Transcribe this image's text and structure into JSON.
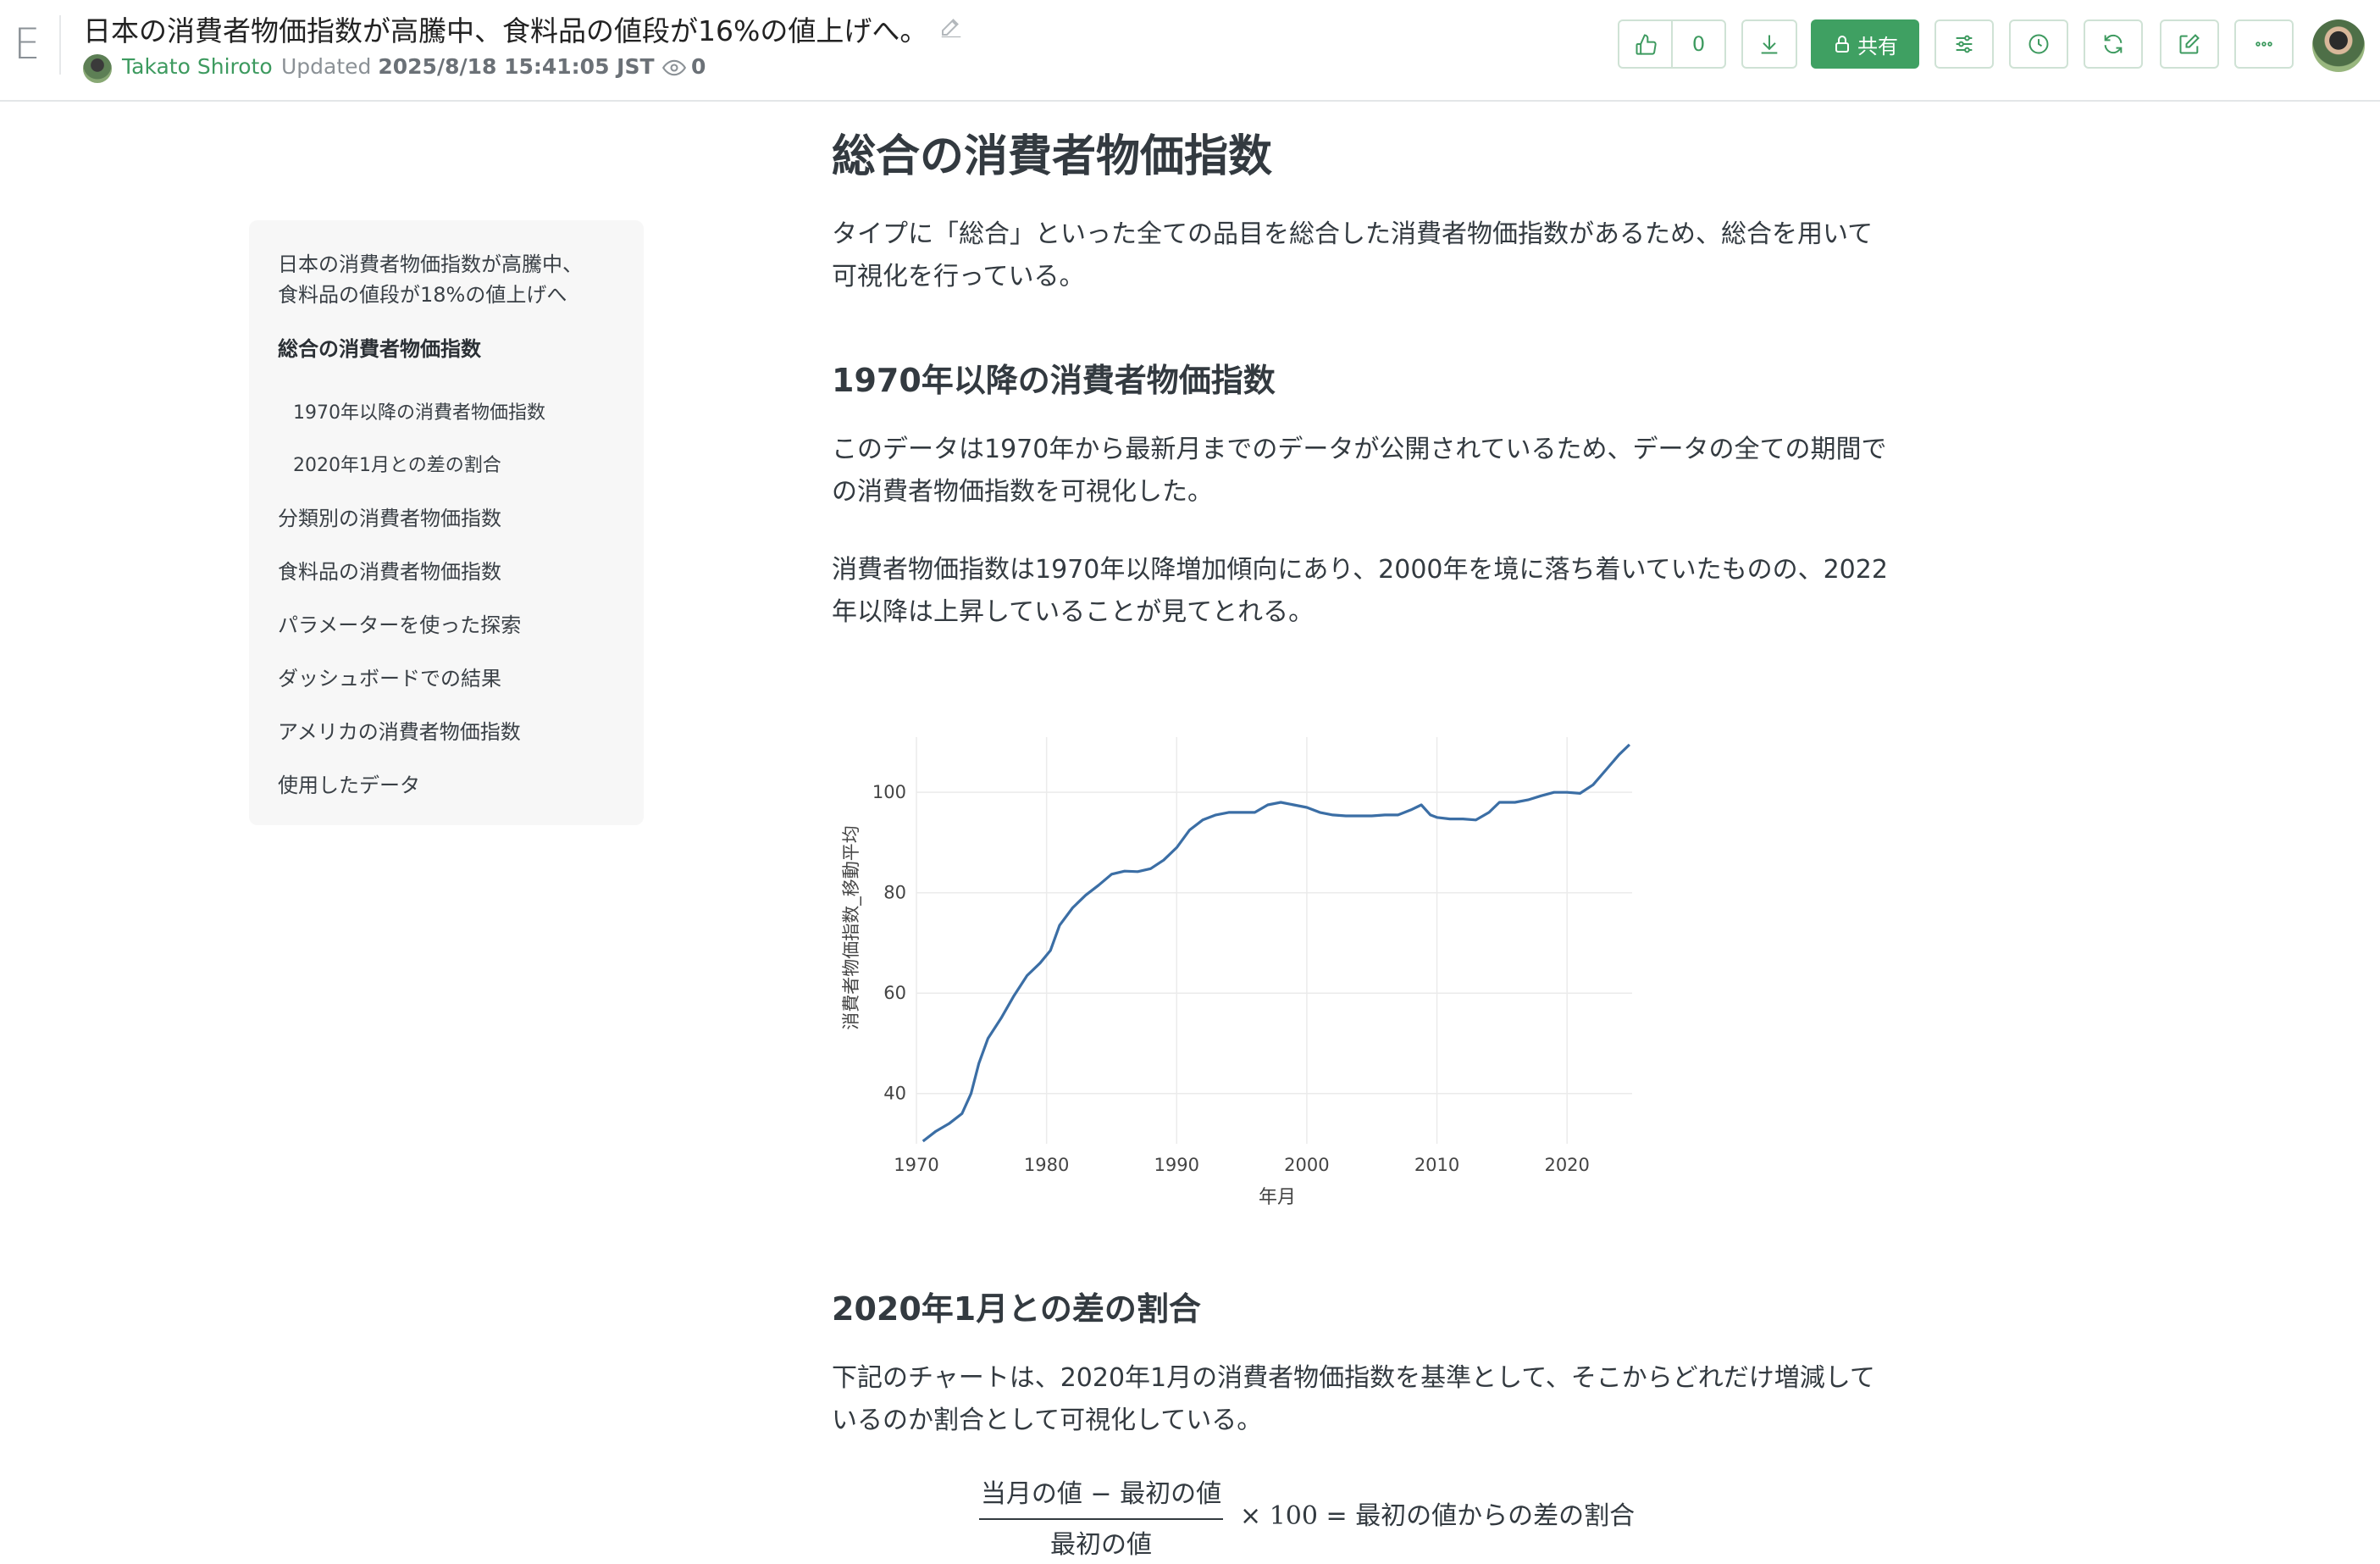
{
  "header": {
    "logo": "E",
    "title": "日本の消費者物価指数が高騰中、食料品の値段が16%の値上げへ。",
    "author": "Takato Shiroto",
    "updated_label": "Updated",
    "updated_value": "2025/8/18 15:41:05 JST",
    "views": "0",
    "likes": "0",
    "share_label": "共有"
  },
  "toc": {
    "items": [
      "日本の消費者物価指数が高騰中、",
      "食料品の値段が18%の値上げへ",
      "総合の消費者物価指数",
      "1970年以降の消費者物価指数",
      "2020年1月との差の割合",
      "分類別の消費者物価指数",
      "食料品の消費者物価指数",
      "パラメーターを使った探索",
      "ダッシュボードでの結果",
      "アメリカの消費者物価指数",
      "使用したデータ"
    ]
  },
  "content": {
    "h1": "総合の消費者物価指数",
    "p1_line1": "タイプに「総合」といった全ての品目を総合した消費者物価指数があるため、総合を用いて",
    "p1_line2": "可視化を行っている。",
    "h2a": "1970年以降の消費者物価指数",
    "p2_line1": "このデータは1970年から最新月までのデータが公開されているため、データの全ての期間で",
    "p2_line2": "の消費者物価指数を可視化した。",
    "p3_line1": "消費者物価指数は1970年以降増加傾向にあり、2000年を境に落ち着いていたものの、2022",
    "p3_line2": "年以降は上昇していることが見てとれる。",
    "h2b": "2020年1月との差の割合",
    "p4_line1": "下記のチャートは、2020年1月の消費者物価指数を基準として、そこからどれだけ増減して",
    "p4_line2": "いるのか割合として可視化している。",
    "formula": {
      "numerator": "当月の値 − 最初の値",
      "denominator": "最初の値",
      "times": "×",
      "hundred": "100",
      "equals": "=",
      "result": "最初の値からの差の割合"
    }
  },
  "chart_data": {
    "type": "line",
    "xlabel": "年月",
    "ylabel": "消費者物価指数_移動平均",
    "xlim": [
      1970,
      2025
    ],
    "ylim": [
      30,
      111
    ],
    "x_ticks": [
      1970,
      1980,
      1990,
      2000,
      2010,
      2020
    ],
    "y_ticks": [
      40,
      60,
      80,
      100
    ],
    "grid": true,
    "color": "#3b6ea5",
    "series": [
      {
        "x": [
          1970.5,
          1971.5,
          1972.5,
          1973.5,
          1974.2,
          1974.8,
          1975.5,
          1976.5,
          1977.5,
          1978.5,
          1979.5,
          1980.3,
          1981,
          1982,
          1983,
          1984,
          1985,
          1986,
          1987,
          1988,
          1989,
          1990,
          1991,
          1992,
          1993,
          1994,
          1995,
          1996,
          1997,
          1998,
          1999,
          2000,
          2001,
          2002,
          2003,
          2004,
          2005,
          2006,
          2007,
          2008,
          2008.8,
          2009.5,
          2010,
          2011,
          2012,
          2013,
          2014,
          2014.8,
          2016,
          2017,
          2018,
          2019,
          2020,
          2021,
          2022,
          2023,
          2024,
          2024.8
        ],
        "y": [
          30.5,
          32.5,
          34,
          36,
          40,
          46,
          51,
          55,
          59.5,
          63.5,
          66,
          68.5,
          73.5,
          77,
          79.5,
          81.5,
          83.7,
          84.3,
          84.2,
          84.8,
          86.5,
          89,
          92.5,
          94.5,
          95.5,
          96,
          96,
          96,
          97.5,
          98,
          97.5,
          97,
          96,
          95.5,
          95.3,
          95.3,
          95.3,
          95.5,
          95.5,
          96.5,
          97.5,
          95.5,
          95,
          94.7,
          94.7,
          94.5,
          96,
          98,
          98,
          98.5,
          99.3,
          100,
          100,
          99.8,
          101.5,
          104.5,
          107.5,
          109.5
        ]
      }
    ]
  }
}
